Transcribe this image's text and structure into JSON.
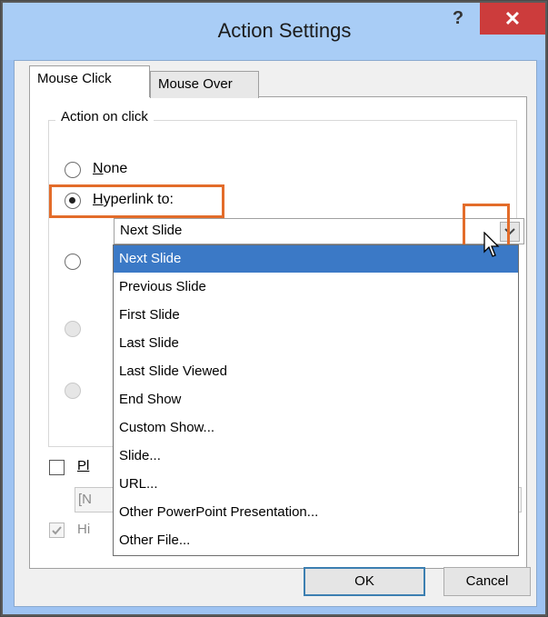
{
  "window": {
    "title": "Action Settings",
    "help_label": "?",
    "close_label": "✕"
  },
  "tabs": [
    {
      "label": "Mouse Click",
      "active": true
    },
    {
      "label": "Mouse Over",
      "active": false
    }
  ],
  "action_group": {
    "label": "Action on click",
    "options": [
      {
        "label": "None",
        "checked": false
      },
      {
        "label": "Hyperlink to:",
        "checked": true
      }
    ]
  },
  "hyperlink_combo": {
    "value": "Next Slide",
    "options": [
      "Next Slide",
      "Previous Slide",
      "First Slide",
      "Last Slide",
      "Last Slide Viewed",
      "End Show",
      "Custom Show...",
      "Slide...",
      "URL...",
      "Other PowerPoint Presentation...",
      "Other File..."
    ],
    "selected_index": 0
  },
  "play_sound": {
    "label_partial": "Pl",
    "checked": false
  },
  "sound_combo": {
    "value_partial": "[N"
  },
  "highlight_click": {
    "label_partial": "Hi",
    "checked": true
  },
  "buttons": {
    "ok": "OK",
    "cancel": "Cancel"
  },
  "colors": {
    "highlight_accent": "#e36c2a",
    "selection": "#3b79c6",
    "close_button": "#cc3c3c",
    "titlebar": "#a9cdf6"
  }
}
